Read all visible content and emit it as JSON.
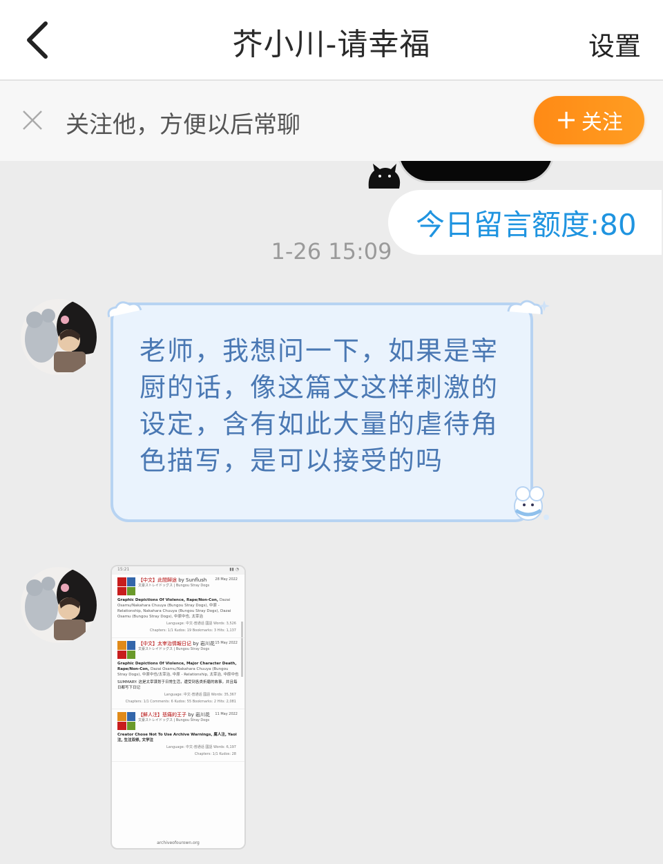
{
  "header": {
    "title": "芥小川-请幸福",
    "settings_label": "设置"
  },
  "follow_bar": {
    "text": "关注他，方便以后常聊",
    "button_plus": "+",
    "button_label": "关注"
  },
  "chat": {
    "quota_text": "今日留言额度:80",
    "timestamp": "1-26 15:09",
    "messages": [
      {
        "type": "text",
        "text": "老师，我想问一下，如果是宰厨的话，像这篇文这样刺激的设定，含有如此大量的虐待角色描写，是可以接受的吗"
      },
      {
        "type": "image",
        "status_time": "15:21",
        "status_icons": "▮▮ ◔",
        "works": [
          {
            "title": "【中文】此間歸途",
            "by": "by Sunflush",
            "date": "28 May 2022",
            "fandom": "文豪ストレイドッグス | Bungou Stray Dogs",
            "warnings": "Graphic Depictions Of Violence, Rape/Non-Con,",
            "tags": "Dazai Osamu/Nakahara Chuuya (Bungou Stray Dogs), 中原 - Relationship, Nakahara Chuuya (Bungou Stray Dogs), Dazai Osamu (Bungou Stray Dogs), 中原中也, 太宰治",
            "stats1": "Language: 中文-普通话 國語   Words: 3,526",
            "stats2": "Chapters: 1/1   Kudos: 19   Bookmarks: 3   Hits: 1,137"
          },
          {
            "title": "【中文】太宰治情報日记",
            "by": "by 岩川花",
            "date": "15 May 2022",
            "fandom": "文豪ストレイドッグス | Bungou Stray Dogs",
            "warnings": "Graphic Depictions Of Violence, Major Character Death, Rape/Non-Con,",
            "tags": "Dazai Osamu/Nakahara Chuuya (Bungou Stray Dogs), 中原中也/太宰治, 中原 - Relationship, 太宰治, 中原中也",
            "summary": "SUMMARY: 这是太宰谋划于日常生活，遭受到各类折磨的故事，并且每日都写下日记",
            "stats1": "Language: 中文-普通话 國語   Words: 35,367",
            "stats2": "Chapters: 1/1   Comments: 6   Kudos: 55   Bookmarks: 2   Hits: 2,081"
          },
          {
            "title": "【鮮人注】悲痛的王子",
            "by": "by 岩川花",
            "date": "11 May 2022",
            "fandom": "文豪ストレイドッグス | Bungou Stray Dogs",
            "warnings": "Creator Chose Not To Use Archive Warnings, 腐人注, Yaoi注, 生注双修, 文学注",
            "stats1": "Language: 中文-普通话 國語   Words: 6,197",
            "stats2": "Chapters: 1/1   Kudos: 28"
          }
        ],
        "url": "archiveofourown.org"
      }
    ]
  },
  "colors": {
    "accent_orange": "#ff8a15",
    "quota_blue": "#1f94e0",
    "bubble_bg": "#eaf3fd",
    "bubble_border": "#b7d3f2",
    "bubble_text": "#4a78b3"
  },
  "icons": {
    "back": "chevron-left-icon",
    "close": "close-icon"
  }
}
